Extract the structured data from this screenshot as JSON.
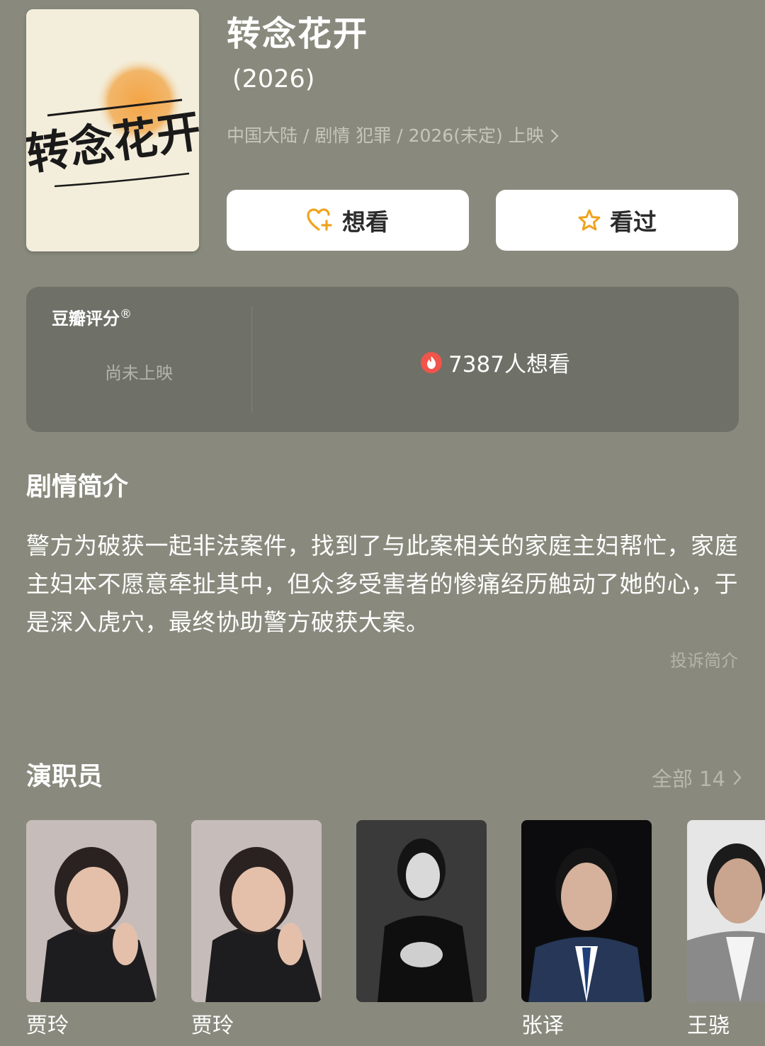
{
  "movie": {
    "title": "转念花开",
    "year": "(2026)",
    "meta": "中国大陆 / 剧情 犯罪 / 2026(未定) 上映",
    "poster_text": "转念花开"
  },
  "actions": {
    "wish_label": "想看",
    "seen_label": "看过"
  },
  "rating": {
    "label": "豆瓣评分",
    "registered_mark": "®",
    "status": "尚未上映",
    "wish_count": "7387人想看"
  },
  "synopsis": {
    "title": "剧情简介",
    "text": "警方为破获一起非法案件，找到了与此案相关的家庭主妇帮忙，家庭主妇本不愿意牵扯其中，但众多受害者的惨痛经历触动了她的心，于是深入虎穴，最终协助警方破获大案。",
    "report_label": "投诉简介"
  },
  "cast": {
    "title": "演职员",
    "view_all_label": "全部 14",
    "members": [
      {
        "name": "贾玲"
      },
      {
        "name": "贾玲"
      },
      {
        "name": ""
      },
      {
        "name": "张译"
      },
      {
        "name": "王骁"
      }
    ]
  },
  "colors": {
    "background": "#898a7d",
    "card": "#6f7067",
    "accent_orange": "#f0a31f",
    "fire_red": "#f0544a"
  }
}
